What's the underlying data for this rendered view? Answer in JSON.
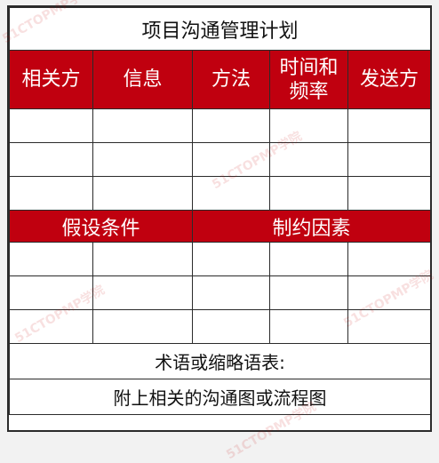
{
  "title": "项目沟通管理计划",
  "headers": [
    "相关方",
    "信息",
    "方法",
    "时间和频率",
    "发送方"
  ],
  "section_headers": [
    "假设条件",
    "制约因素"
  ],
  "glossary_label": "术语或缩略语表:",
  "attachment_label": "附上相关的沟通图或流程图",
  "watermark": "51CTOPMP学院",
  "colors": {
    "header_red": "#c0000f",
    "border": "#2b2b2b"
  }
}
